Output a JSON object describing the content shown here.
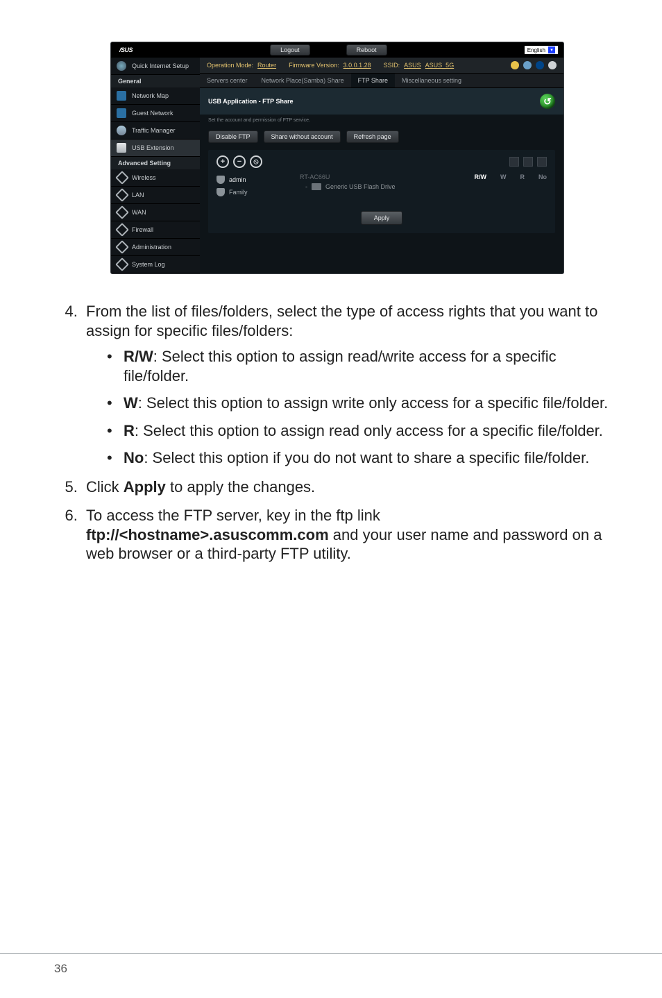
{
  "shot": {
    "brand": "/SUS",
    "logout": "Logout",
    "reboot": "Reboot",
    "language": "English",
    "info_mode_label": "Operation Mode:",
    "info_mode_value": "Router",
    "info_fw_label": "Firmware Version:",
    "info_fw_value": "3.0.0.1.28",
    "info_ssid_label": "SSID:",
    "info_ssid_value1": "ASUS",
    "info_ssid_value2": "ASUS_5G",
    "tabs": {
      "servers": "Servers center",
      "samba": "Network Place(Samba) Share",
      "ftp": "FTP Share",
      "misc": "Miscellaneous setting"
    },
    "side": {
      "qis": "Quick Internet Setup",
      "general": "General",
      "netmap": "Network Map",
      "guest": "Guest Network",
      "traffic": "Traffic Manager",
      "usb": "USB Extension",
      "advset": "Advanced Setting",
      "wireless": "Wireless",
      "lan": "LAN",
      "wan": "WAN",
      "firewall": "Firewall",
      "admin": "Administration",
      "syslog": "System Log"
    },
    "section_title": "USB Application - FTP Share",
    "subtext": "Set the account and permission of FTP service.",
    "btn_disable": "Disable FTP",
    "btn_share": "Share without account",
    "btn_refresh": "Refresh page",
    "acct_admin": "admin",
    "acct_family": "Family",
    "device": "RT-AC66U",
    "drive": "Generic USB Flash Drive",
    "perm_rw": "R/W",
    "perm_w": "W",
    "perm_r": "R",
    "perm_no": "No",
    "apply": "Apply"
  },
  "doc": {
    "step4": "From the list of files/folders, select the type of access rights that you want to assign for specific files/folders:",
    "rw_label": "R/W",
    "rw_text": ": Select this option to assign read/write access for a specific file/folder.",
    "w_label": "W",
    "w_text": ": Select this option to assign write only access for a specific file/folder.",
    "r_label": "R",
    "r_text": ": Select this option to assign read only access for a specific file/folder.",
    "no_label": "No",
    "no_text": ": Select this option if you do not want to share a specific file/folder.",
    "step5_a": "Click ",
    "step5_b": "Apply",
    "step5_c": " to apply the changes.",
    "step6_a": "To access the FTP server, key in the ftp link ",
    "step6_b": "ftp://<hostname>.asuscomm.com",
    "step6_c": " and your user name and password on a web browser or a third-party FTP utility.",
    "pagenum": "36"
  }
}
